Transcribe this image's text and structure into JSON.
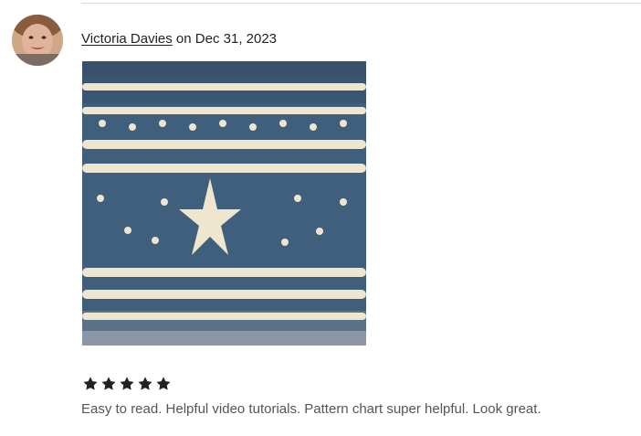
{
  "review": {
    "author": "Victoria Davies",
    "date_prefix": " on ",
    "date": "Dec 31, 2023",
    "rating": 5,
    "rating_max": 5,
    "text": "Easy to read. Helpful video tutorials. Pattern chart super helpful. Look great."
  },
  "icons": {
    "star": "star-icon",
    "avatar": "user-avatar-photo",
    "photo": "knitted-hat-photo"
  },
  "colors": {
    "text_primary": "#222222",
    "text_secondary": "#555555",
    "divider": "#d9d9d9",
    "hat_blue": "#3f5f7c",
    "hat_cream": "#efe6cf"
  }
}
